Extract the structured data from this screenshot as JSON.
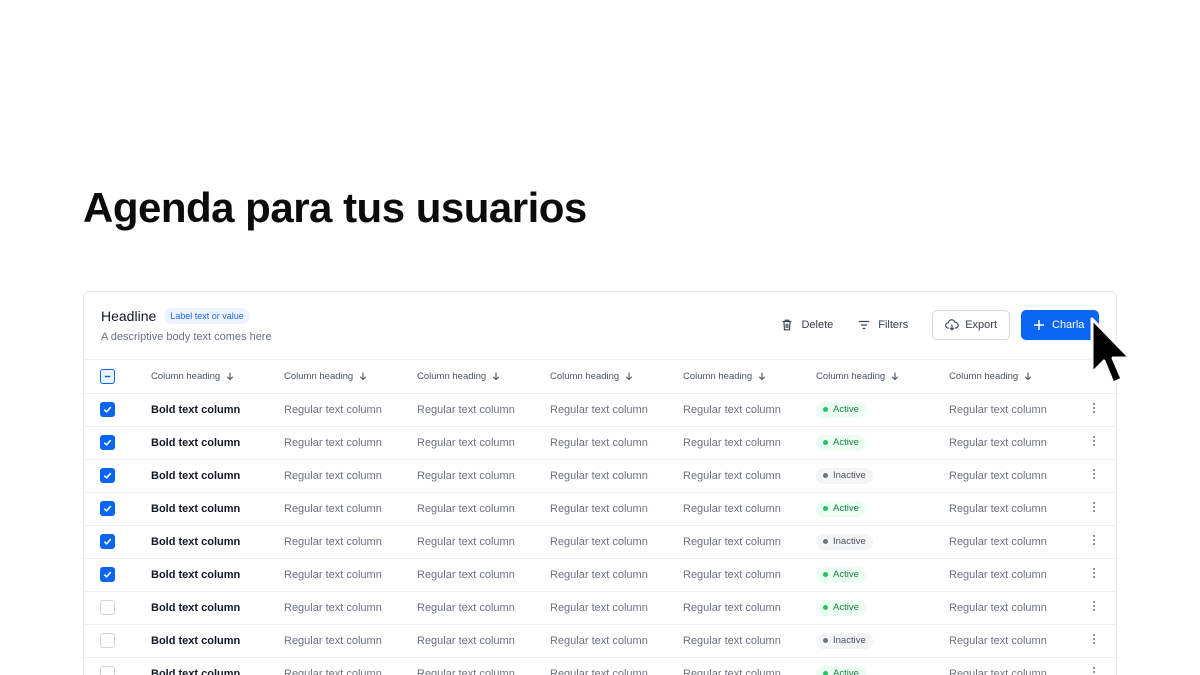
{
  "page": {
    "title": "Agenda para tus usuarios"
  },
  "card": {
    "headline": "Headline",
    "badge": "Label text or value",
    "description": "A descriptive body text comes here",
    "actions": {
      "delete": "Delete",
      "filters": "Filters",
      "export": "Export",
      "primary": "Charla"
    }
  },
  "table": {
    "headers": [
      "Column heading",
      "Column heading",
      "Column heading",
      "Column heading",
      "Column heading",
      "Column heading",
      "Column heading"
    ],
    "rows": [
      {
        "checked": true,
        "bold": "Bold text column",
        "c2": "Regular text column",
        "c3": "Regular text column",
        "c4": "Regular text column",
        "c5": "Regular text column",
        "status": "Active",
        "c7": "Regular text column"
      },
      {
        "checked": true,
        "bold": "Bold text column",
        "c2": "Regular text column",
        "c3": "Regular text column",
        "c4": "Regular text column",
        "c5": "Regular text column",
        "status": "Active",
        "c7": "Regular text column"
      },
      {
        "checked": true,
        "bold": "Bold text column",
        "c2": "Regular text column",
        "c3": "Regular text column",
        "c4": "Regular text column",
        "c5": "Regular text column",
        "status": "Inactive",
        "c7": "Regular text column"
      },
      {
        "checked": true,
        "bold": "Bold text column",
        "c2": "Regular text column",
        "c3": "Regular text column",
        "c4": "Regular text column",
        "c5": "Regular text column",
        "status": "Active",
        "c7": "Regular text column"
      },
      {
        "checked": true,
        "bold": "Bold text column",
        "c2": "Regular text column",
        "c3": "Regular text column",
        "c4": "Regular text column",
        "c5": "Regular text column",
        "status": "Inactive",
        "c7": "Regular text column"
      },
      {
        "checked": true,
        "bold": "Bold text column",
        "c2": "Regular text column",
        "c3": "Regular text column",
        "c4": "Regular text column",
        "c5": "Regular text column",
        "status": "Active",
        "c7": "Regular text column"
      },
      {
        "checked": false,
        "bold": "Bold text column",
        "c2": "Regular text column",
        "c3": "Regular text column",
        "c4": "Regular text column",
        "c5": "Regular text column",
        "status": "Active",
        "c7": "Regular text column"
      },
      {
        "checked": false,
        "bold": "Bold text column",
        "c2": "Regular text column",
        "c3": "Regular text column",
        "c4": "Regular text column",
        "c5": "Regular text column",
        "status": "Inactive",
        "c7": "Regular text column"
      },
      {
        "checked": false,
        "bold": "Bold text column",
        "c2": "Regular text column",
        "c3": "Regular text column",
        "c4": "Regular text column",
        "c5": "Regular text column",
        "status": "Active",
        "c7": "Regular text column"
      }
    ]
  },
  "colors": {
    "primary": "#0a66f2",
    "active": "#22c55e",
    "inactive": "#6b7280"
  },
  "icons": {
    "delete": "trash-icon",
    "filters": "filter-icon",
    "export": "cloud-download-icon",
    "primary": "plus-icon",
    "sort": "arrow-down-icon",
    "row_menu": "more-vertical-icon",
    "pointer": "mouse-cursor-icon"
  }
}
